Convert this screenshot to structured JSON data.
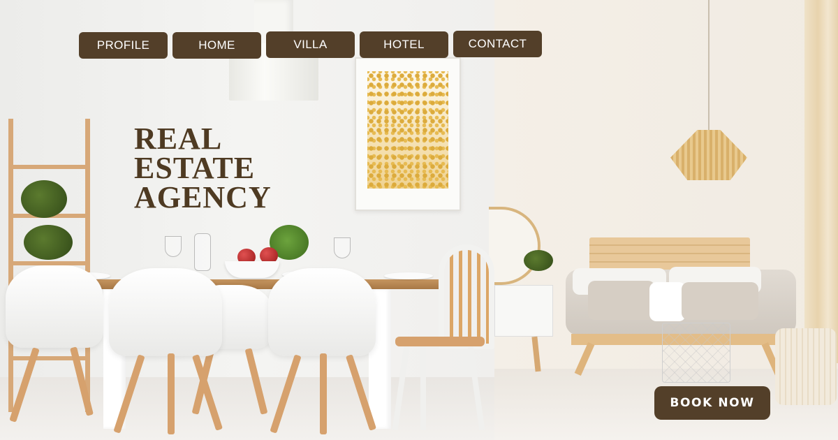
{
  "nav": {
    "items": [
      {
        "label": "PROFILE"
      },
      {
        "label": "HOME"
      },
      {
        "label": "VILLA"
      },
      {
        "label": "HOTEL"
      },
      {
        "label": "CONTACT"
      }
    ]
  },
  "hero": {
    "title_lines": [
      "REAL",
      "ESTATE",
      "AGENCY"
    ]
  },
  "cta": {
    "label": "BOOK NOW"
  },
  "colors": {
    "button_bg": "#533f29",
    "button_text": "#ffffff",
    "title": "#4e3a22"
  }
}
